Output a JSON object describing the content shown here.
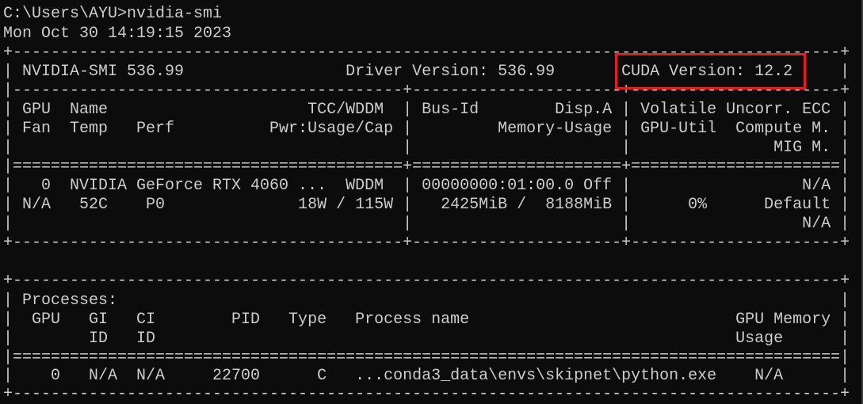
{
  "terminal": {
    "lines": [
      "C:\\Users\\AYU>nvidia-smi",
      "Mon Oct 30 14:19:15 2023",
      "+---------------------------------------------------------------------------------------+",
      "| NVIDIA-SMI 536.99                 Driver Version: 536.99       CUDA Version: 12.2     |",
      "|-----------------------------------------+----------------------+----------------------+",
      "| GPU  Name                     TCC/WDDM  | Bus-Id        Disp.A | Volatile Uncorr. ECC |",
      "| Fan  Temp   Perf          Pwr:Usage/Cap |         Memory-Usage | GPU-Util  Compute M. |",
      "|                                         |                      |               MIG M. |",
      "|=========================================+======================+======================|",
      "|   0  NVIDIA GeForce RTX 4060 ...  WDDM  | 00000000:01:00.0 Off |                  N/A |",
      "| N/A   52C    P0              18W / 115W |   2425MiB /  8188MiB |      0%      Default |",
      "|                                         |                      |                  N/A |",
      "+-----------------------------------------+----------------------+----------------------+",
      "",
      "+---------------------------------------------------------------------------------------+",
      "| Processes:                                                                            |",
      "|  GPU   GI   CI        PID   Type   Process name                            GPU Memory |",
      "|        ID   ID                                                             Usage      |",
      "|=======================================================================================|",
      "|    0   N/A  N/A     22700      C   ...conda3_data\\envs\\skipnet\\python.exe    N/A      |",
      "+---------------------------------------------------------------------------------------+"
    ]
  },
  "colors": {
    "background": "#0c0c0c",
    "text": "#cccccc",
    "highlight_border": "#e02020"
  }
}
